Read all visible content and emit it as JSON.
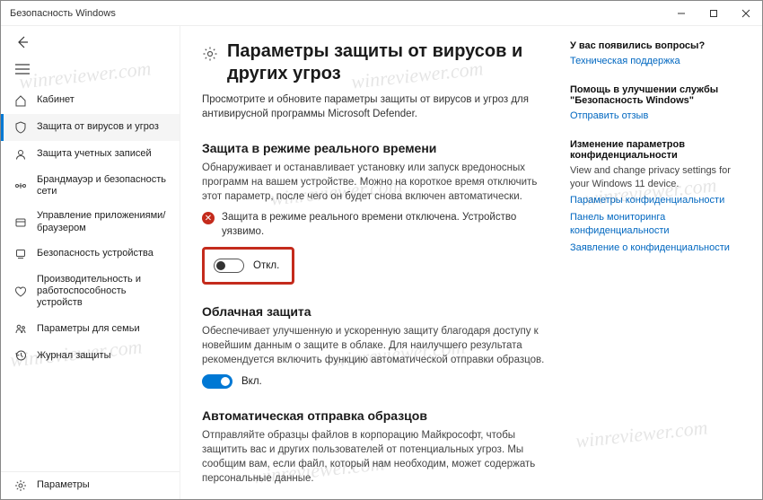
{
  "window": {
    "title": "Безопасность Windows"
  },
  "sidebar": {
    "items": [
      {
        "label": "Кабинет"
      },
      {
        "label": "Защита от вирусов и угроз"
      },
      {
        "label": "Защита учетных записей"
      },
      {
        "label": "Брандмауэр и безопасность сети"
      },
      {
        "label": "Управление приложениями/браузером"
      },
      {
        "label": "Безопасность устройства"
      },
      {
        "label": "Производительность и работоспособность устройств"
      },
      {
        "label": "Параметры для семьи"
      },
      {
        "label": "Журнал защиты"
      }
    ],
    "settings": "Параметры"
  },
  "page": {
    "title": "Параметры защиты от вирусов и других угроз",
    "desc": "Просмотрите и обновите параметры защиты от вирусов и угроз для антивирусной программы Microsoft Defender."
  },
  "sections": {
    "realtime": {
      "title": "Защита в режиме реального времени",
      "desc": "Обнаруживает и останавливает установку или запуск вредоносных программ на вашем устройстве. Можно на короткое время отключить этот параметр, после чего он будет снова включен автоматически.",
      "warning": "Защита в режиме реального времени отключена. Устройство уязвимо.",
      "toggle_label": "Откл.",
      "toggle_on": false
    },
    "cloud": {
      "title": "Облачная защита",
      "desc": "Обеспечивает улучшенную и ускоренную защиту благодаря доступу к новейшим данным о защите в облаке. Для наилучшего результата рекомендуется включить функцию автоматической отправки образцов.",
      "toggle_label": "Вкл.",
      "toggle_on": true
    },
    "samples": {
      "title": "Автоматическая отправка образцов",
      "desc": "Отправляйте образцы файлов в корпорацию Майкрософт, чтобы защитить вас и других пользователей от потенциальных угроз. Мы сообщим вам, если файл, который нам необходим, может содержать персональные данные."
    }
  },
  "aside": {
    "questions": {
      "title": "У вас появились вопросы?",
      "link": "Техническая поддержка"
    },
    "feedback": {
      "title": "Помощь в улучшении службы \"Безопасность Windows\"",
      "link": "Отправить отзыв"
    },
    "privacy": {
      "title": "Изменение параметров конфиденциальности",
      "text": "View and change privacy settings for your Windows 11 device.",
      "links": [
        "Параметры конфиденциальности",
        "Панель мониторинга конфиденциальности",
        "Заявление о конфиденциальности"
      ]
    }
  },
  "watermark": "winreviewer.com"
}
